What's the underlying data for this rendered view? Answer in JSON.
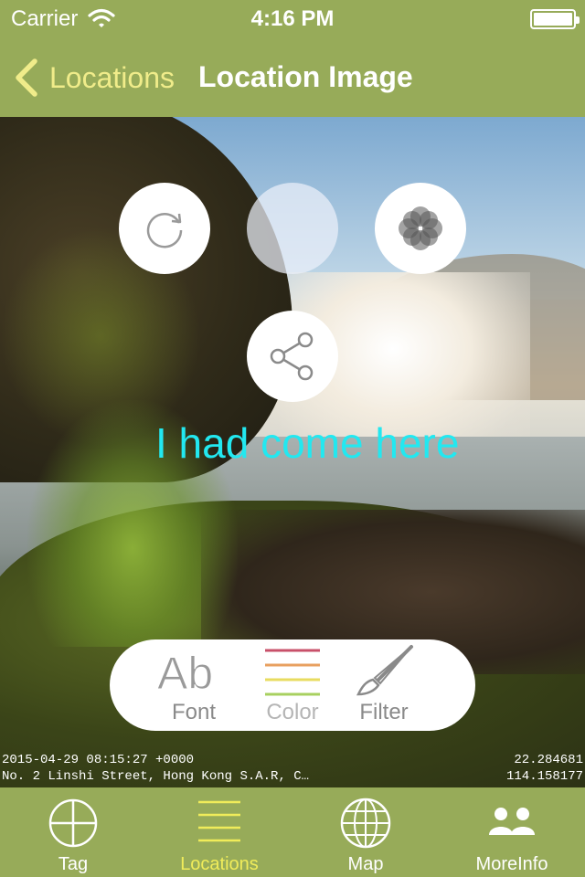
{
  "status_bar": {
    "carrier": "Carrier",
    "time": "4:16 PM"
  },
  "nav": {
    "back_label": "Locations",
    "title": "Location Image"
  },
  "overlay": {
    "caption": "I had come here",
    "caption_color": "#22e8f0",
    "icons": [
      "rotate-icon",
      "blank-circle",
      "flower-icon",
      "share-icon"
    ]
  },
  "toolbar": {
    "font_label": "Font",
    "color_label": "Color",
    "filter_label": "Filter"
  },
  "meta": {
    "datetime": "2015-04-29 08:15:27 +0000",
    "address": "No. 2 Linshi Street, Hong Kong S.A.R, C…",
    "latitude": "22.284681",
    "longitude": "114.158177"
  },
  "tabs": [
    {
      "label": "Tag",
      "icon": "crosshair-icon",
      "active": false
    },
    {
      "label": "Locations",
      "icon": "list-icon",
      "active": true
    },
    {
      "label": "Map",
      "icon": "globe-icon",
      "active": false
    },
    {
      "label": "MoreInfo",
      "icon": "people-icon",
      "active": false
    }
  ],
  "colors": {
    "bar": "#97ab59",
    "accent": "#f0ec8a",
    "active_tab": "#f0ec5a"
  }
}
